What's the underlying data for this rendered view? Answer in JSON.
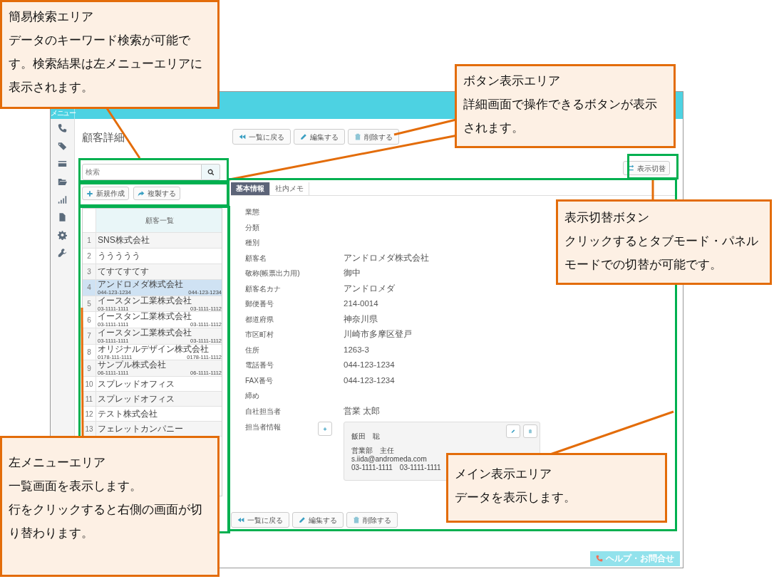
{
  "app": {
    "menu_label": "メニュー",
    "page_title": "顧客詳細",
    "toolbar_buttons": [
      {
        "label": "一覧に戻る",
        "kind": "back"
      },
      {
        "label": "編集する",
        "kind": "edit"
      },
      {
        "label": "削除する",
        "kind": "delete"
      }
    ],
    "search": {
      "placeholder": "検索"
    },
    "list_actions": [
      {
        "label": "新規作成",
        "kind": "add"
      },
      {
        "label": "複製する",
        "kind": "copy"
      }
    ],
    "customer_list": {
      "header": "顧客一覧",
      "rows": [
        {
          "no": "1",
          "name": "SNS株式会社",
          "selected": false
        },
        {
          "no": "2",
          "name": "ううううう",
          "selected": false
        },
        {
          "no": "3",
          "name": "てすてすてす",
          "selected": false
        },
        {
          "no": "4",
          "name": "アンドロメダ株式会社",
          "phone": "044-123-1234",
          "fax": "044-123-1234",
          "selected": true
        },
        {
          "no": "5",
          "name": "イースタン工業株式会社",
          "phone": "03-1111-1111",
          "fax": "03-1111-1112",
          "selected": false
        },
        {
          "no": "6",
          "name": "イースタン工業株式会社",
          "phone": "03-1111-1111",
          "fax": "03-1111-1112",
          "selected": false
        },
        {
          "no": "7",
          "name": "イースタン工業株式会社",
          "phone": "03-1111-1111",
          "fax": "03-1111-1112",
          "selected": false
        },
        {
          "no": "8",
          "name": "オリジナルデザイン株式会社",
          "phone": "0178-111-1111",
          "fax": "0178-111-1112",
          "selected": false
        },
        {
          "no": "9",
          "name": "サンプル株式会社",
          "phone": "06-1111-1111",
          "fax": "06-1111-1112",
          "selected": false
        },
        {
          "no": "10",
          "name": "スプレッドオフィス",
          "selected": false
        },
        {
          "no": "11",
          "name": "スプレッドオフィス",
          "selected": false
        },
        {
          "no": "12",
          "name": "テスト株式会社",
          "selected": false
        },
        {
          "no": "13",
          "name": "フェレットカンパニー",
          "selected": false
        }
      ]
    },
    "view_toggle": {
      "label": "表示切替"
    },
    "tabs": [
      {
        "label": "基本情報",
        "selected": true
      },
      {
        "label": "社内メモ",
        "selected": false
      }
    ],
    "fields": [
      {
        "label": "業態"
      },
      {
        "label": "分類"
      },
      {
        "label": "種別"
      },
      {
        "label": "顧客名",
        "value": "アンドロメダ株式会社"
      },
      {
        "label": "敬称(帳票出力用)",
        "value": "御中"
      },
      {
        "label": "顧客名カナ",
        "value": "アンドロメダ"
      },
      {
        "label": "郵便番号",
        "value": "214-0014"
      },
      {
        "label": "都道府県",
        "value": "神奈川県"
      },
      {
        "label": "市区町村",
        "value": "川崎市多摩区登戸"
      },
      {
        "label": "住所",
        "value": "1263-3"
      },
      {
        "label": "電話番号",
        "value": "044-123-1234"
      },
      {
        "label": "FAX番号",
        "value": "044-123-1234"
      },
      {
        "label": "締め"
      },
      {
        "label": "自社担当者",
        "value": "営業 太郎"
      }
    ],
    "contact": {
      "label": "担当者情報",
      "name": "飯田　聡",
      "position": "営業部　主任",
      "email": "s.iida@andromeda.com",
      "phones": "03-1111-1111　03-1111-1111"
    },
    "bottom_buttons": [
      {
        "label": "一覧に戻る",
        "kind": "back"
      },
      {
        "label": "編集する",
        "kind": "edit"
      },
      {
        "label": "削除する",
        "kind": "delete"
      }
    ],
    "help_button": "ヘルプ・お問合せ"
  },
  "callouts": [
    {
      "title": "簡易検索エリア",
      "body": [
        "データのキーワード検索が可能です。検索結果は左メニューエリアに表示されます。"
      ]
    },
    {
      "title": "ボタン表示エリア",
      "body": [
        "詳細画面で操作できるボタンが表示されます。"
      ]
    },
    {
      "title": "表示切替ボタン",
      "body": [
        "クリックするとタブモード・パネルモードでの切替が可能です。"
      ]
    },
    {
      "title": "左メニューエリア",
      "body": [
        "一覧画面を表示します。",
        "行をクリックすると右側の画面が切り替わります。"
      ]
    },
    {
      "title": "メイン表示エリア",
      "body": [
        "データを表示します。"
      ]
    }
  ]
}
